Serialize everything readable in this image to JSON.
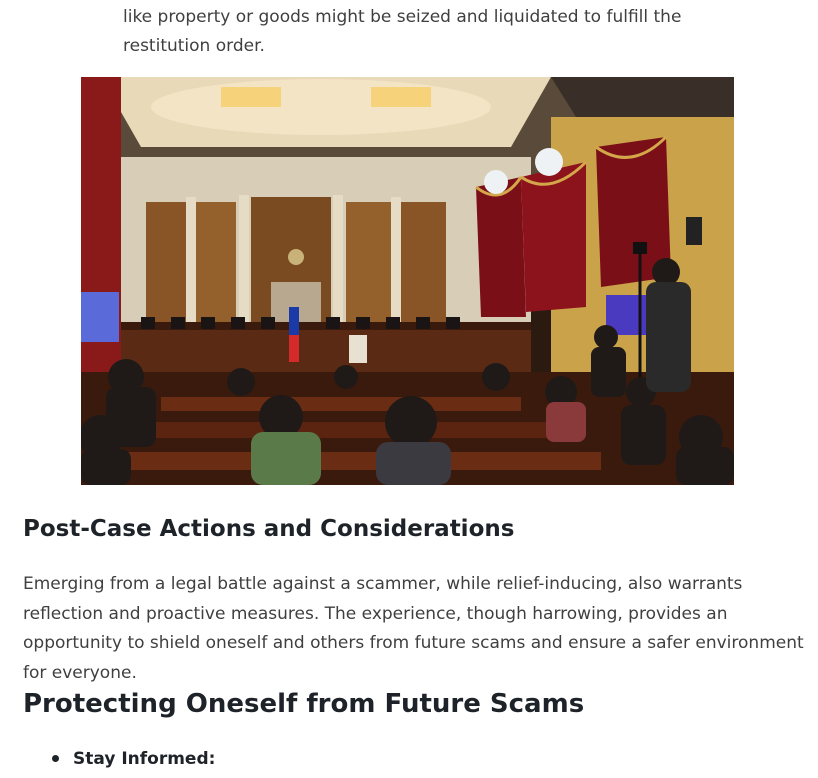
{
  "intro": {
    "paragraph_tail": "like property or goods might be seized and liquidated to fulfill the restitution order."
  },
  "photo": {
    "description_icon": "courtroom-photo"
  },
  "post_case": {
    "heading": "Post-Case Actions and Considerations",
    "paragraph": "Emerging from a legal battle against a scammer, while relief-inducing, also warrants reflection and proactive measures. The experience, though harrowing, provides an opportunity to shield oneself and others from future scams and ensure a safer environment for everyone."
  },
  "protecting": {
    "heading": "Protecting Oneself from Future Scams",
    "items": [
      {
        "label": "Stay Informed:"
      }
    ]
  }
}
